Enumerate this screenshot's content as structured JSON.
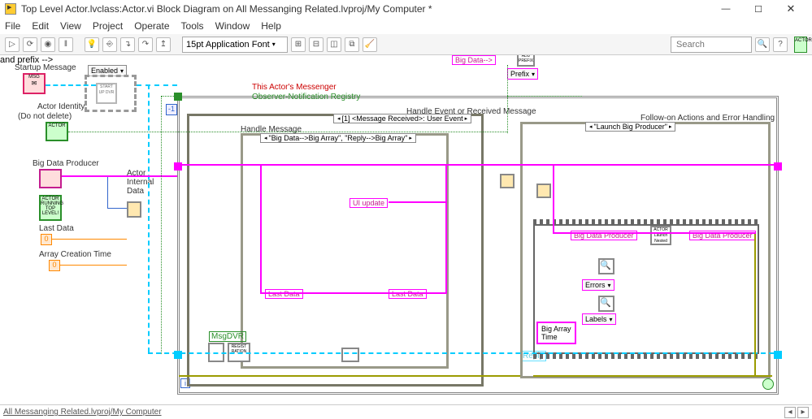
{
  "window": {
    "title": "Top Level Actor.lvclass:Actor.vi Block Diagram on All Messanging Related.lvproj/My Computer *",
    "minimize": "—",
    "maximize": "☐",
    "close": "✕"
  },
  "menu": {
    "file": "File",
    "edit": "Edit",
    "view": "View",
    "project": "Project",
    "operate": "Operate",
    "tools": "Tools",
    "window": "Window",
    "help": "Help"
  },
  "toolbar": {
    "font": "15pt Application Font",
    "search_placeholder": "Search",
    "search_tip": "?"
  },
  "diagram": {
    "startup_message": "Startup Message",
    "actor_identity": "Actor Identity",
    "actor_identity_note": "(Do not delete)",
    "big_data_producer": "Big Data Producer",
    "actor_internal_data": "Actor\nInternal\nData",
    "last_data": "Last Data",
    "array_creation_time": "Array Creation Time",
    "enabled": "Enabled",
    "actors_messenger": "This Actor's Messenger",
    "observer_registry": "Observer-Notification Registry",
    "big_data_arrow": "Big Data-->",
    "prefix": "Prefix",
    "handle_event": "Handle Event or Received Message",
    "event_case": "[1] <Message Received>: User Event",
    "handle_message": "Handle Message",
    "msg_case": "\"Big Data-->Big Array\", \"Reply-->Big Array\"",
    "ui_update": "UI update",
    "last_data2": "Last Data",
    "last_data3": "Last Data",
    "msgdvr": "MsgDVR",
    "reply": "Reply",
    "followon": "Follow-on Actions and Error Handling",
    "launch_case": "\"Launch Big Producer\"",
    "big_data_producer2": "Big Data Producer",
    "big_data_producer3": "Big Data Producer",
    "errors": "Errors",
    "labels_opt": "Labels",
    "big_array": "Big Array",
    "time": "Time",
    "neg1": "-1",
    "zero": "0",
    "zero2": "0",
    "actor_launch": "ACTOR\nLaunch\nNested",
    "reg_label": "REGIST\nRATION",
    "msg_icon": "MSG",
    "add_prefix": "ADD\nPREFIX",
    "start_up_dvr": "START\nUP\nDVR",
    "running_top": "ACTOR\nRUNNING\nTOP\nLEVEL!"
  },
  "footer": {
    "path": "All Messanging Related.lvproj/My Computer",
    "left": "◂",
    "right": "▸"
  }
}
